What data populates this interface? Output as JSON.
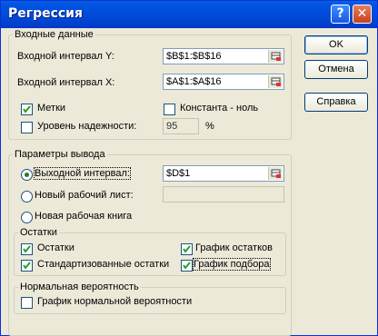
{
  "window": {
    "title": "Регрессия",
    "help_glyph": "?",
    "close_glyph": "✕"
  },
  "input": {
    "legend": "Входные данные",
    "y_label": "Входной интервал Y:",
    "y_value": "$B$1:$B$16",
    "x_label": "Входной интервал X:",
    "x_value": "$A$1:$A$16",
    "labels_label": "Метки",
    "labels_checked": true,
    "const_zero_label": "Константа - ноль",
    "const_zero_checked": false,
    "confidence_label": "Уровень надежности:",
    "confidence_checked": false,
    "confidence_value": "95",
    "percent": "%"
  },
  "output": {
    "legend": "Параметры вывода",
    "range_label": "Выходной интервал:",
    "range_value": "$D$1",
    "new_sheet_label": "Новый рабочий лист:",
    "new_sheet_value": "",
    "new_book_label": "Новая рабочая книга",
    "selected": "range"
  },
  "residuals": {
    "legend": "Остатки",
    "residuals_label": "Остатки",
    "residuals_checked": true,
    "std_residuals_label": "Стандартизованные остатки",
    "std_residuals_checked": true,
    "residual_plot_label": "График остатков",
    "residual_plot_checked": true,
    "fit_plot_label": "График подбора",
    "fit_plot_checked": true
  },
  "normal": {
    "legend": "Нормальная вероятность",
    "plot_label": "График нормальной вероятности",
    "plot_checked": false
  },
  "buttons": {
    "ok": "OK",
    "cancel": "Отмена",
    "help": "Справка"
  },
  "colors": {
    "title_bar": "#0054e3",
    "dialog_bg": "#ece9d8",
    "check_mark": "#21a121"
  }
}
